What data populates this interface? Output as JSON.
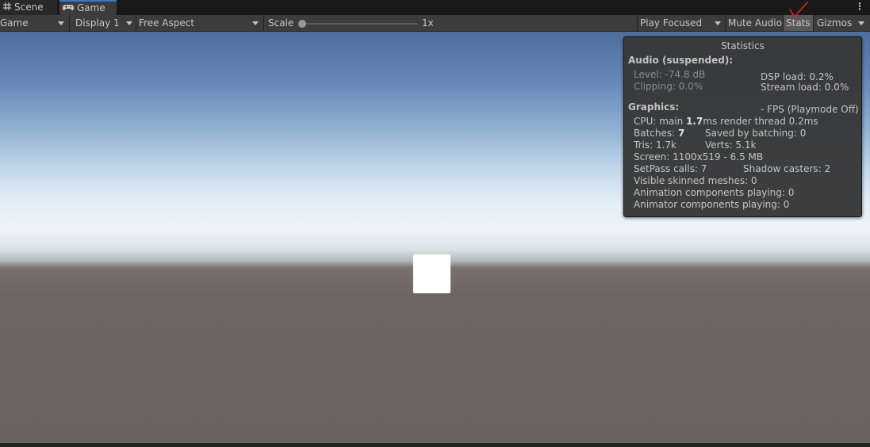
{
  "tabs": [
    {
      "label": "Scene",
      "icon": "grid-icon"
    },
    {
      "label": "Game",
      "icon": "gamepad-icon"
    }
  ],
  "toolbar": {
    "view_mode": "Game",
    "display": "Display 1",
    "aspect": "Free Aspect",
    "scale_label": "Scale",
    "scale_value": "1x",
    "play_mode": "Play Focused",
    "mute_audio": "Mute Audio",
    "stats": "Stats",
    "gizmos": "Gizmos"
  },
  "stats": {
    "title": "Statistics",
    "audio_heading": "Audio (suspended):",
    "level": "Level: -74.8 dB",
    "clipping": "Clipping: 0.0%",
    "dsp_load": "DSP load: 0.2%",
    "stream_load": "Stream load: 0.0%",
    "graphics_heading": "Graphics:",
    "fps": "- FPS (Playmode Off)",
    "cpu_prefix": "CPU: main ",
    "cpu_main": "1.7",
    "cpu_suffix": "ms  render thread 0.2ms",
    "batches_prefix": "Batches: ",
    "batches": "7",
    "saved_by_batching": "Saved by batching: 0",
    "tris": "Tris: 1.7k",
    "verts": "Verts: 5.1k",
    "screen": "Screen: 1100x519 - 6.5 MB",
    "setpass": "SetPass calls: 7",
    "shadow_casters": "Shadow casters: 2",
    "skinned_meshes": "Visible skinned meshes: 0",
    "animation_components": "Animation components playing: 0",
    "animator_components": "Animator components playing: 0"
  },
  "colors": {
    "toolbar_bg": "#3c3c3c",
    "active_tab_accent": "#3a79bb",
    "annotation_check": "#e0201f",
    "cube": "#fefefe"
  }
}
